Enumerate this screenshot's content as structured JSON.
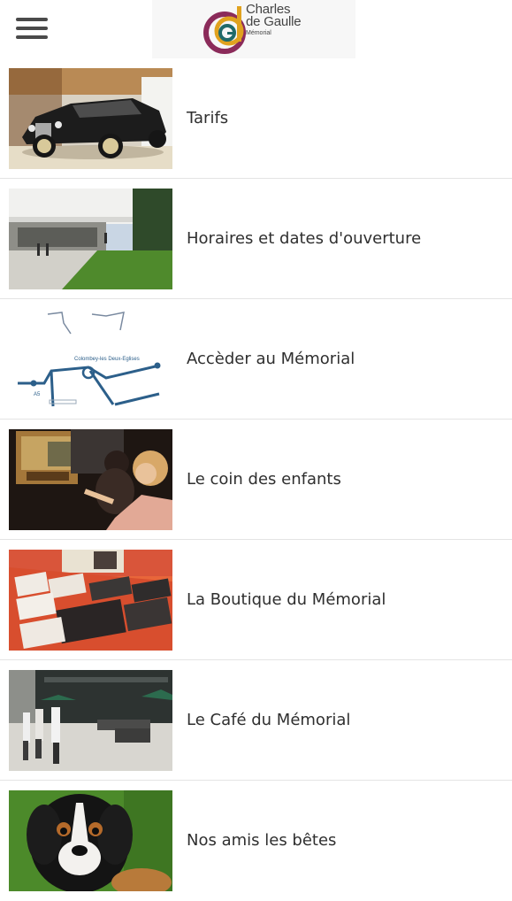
{
  "header": {
    "menu_icon": "hamburger-menu-icon",
    "logo": {
      "line1": "Charles",
      "line2": "de Gaulle",
      "line3": "Mémorial",
      "colors": {
        "c": "#8b2b5a",
        "d": "#e0a21f",
        "g": "#1f6a6a"
      }
    }
  },
  "menu": {
    "items": [
      {
        "label": "Tarifs",
        "image": "vintage-car-photo"
      },
      {
        "label": "Horaires et dates d'ouverture",
        "image": "memorial-building-photo"
      },
      {
        "label": "Accèder au Mémorial",
        "image": "access-map-photo"
      },
      {
        "label": "Le coin des enfants",
        "image": "children-exhibit-photo"
      },
      {
        "label": "La Boutique du Mémorial",
        "image": "gift-shop-books-photo"
      },
      {
        "label": "Le Café du Mémorial",
        "image": "cafe-terrace-photo"
      },
      {
        "label": "Nos amis les bêtes",
        "image": "bernese-dog-photo"
      }
    ]
  },
  "map_labels": {
    "town": "Colombey-les Deux-Eglises",
    "road": "A5"
  }
}
